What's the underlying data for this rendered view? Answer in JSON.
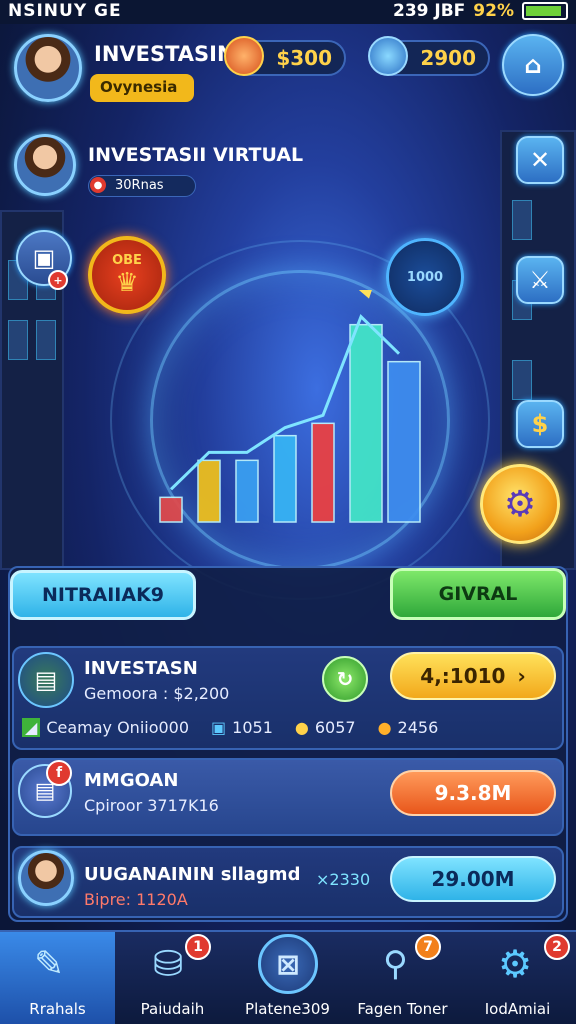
{
  "status_bar": {
    "left": "NSINUY GE",
    "time": "239 JBF",
    "battery": "92%",
    "battery_level": 0.92
  },
  "header": {
    "player_name": "INVESTASIN",
    "player_subtitle": "Ovynesia",
    "currency_coins": "$300",
    "currency_gems": "2900",
    "home_icon": "home-icon"
  },
  "profile": {
    "title": "INVESTASII VIRTUAL",
    "subtitle": "30Rnas"
  },
  "hud_left": {
    "badge_text": "OBE"
  },
  "hud_right": {
    "dial_text": "1000",
    "sword_icon": "sword-icon",
    "dollar_icon": "dollar-icon",
    "gear_icon": "gear-icon",
    "close_icon": "close-icon"
  },
  "chart_data": {
    "type": "bar",
    "values": [
      2,
      5,
      5,
      7,
      8,
      16,
      13
    ],
    "categories": [
      "",
      "",
      "",
      "",
      "",
      "",
      ""
    ],
    "series_colors": [
      "#e34a4a",
      "#f2c21b",
      "#3aa0f2",
      "#37b5f5",
      "#ee4040",
      "#43e8c8",
      "#3e8ef0"
    ]
  },
  "tabs": {
    "left": "NITRAIIAK9",
    "right": "GIVRAL"
  },
  "rows": [
    {
      "title": "INVESTASN",
      "subtitle": "Gemoora : $2,200",
      "button": "4,:1010",
      "stats": [
        {
          "label": "Ceamay Oniio000"
        },
        {
          "label": "1051"
        },
        {
          "label": "6057"
        },
        {
          "label": "2456"
        }
      ]
    },
    {
      "title": "MMGOAN",
      "subtitle": "Cpiroor 3717K16",
      "button": "9.3.8M"
    },
    {
      "title": "UUGANAININ sllagmd",
      "subtitle": "Bipre: 1120A",
      "extra": "×2330",
      "button": "29.00M"
    }
  ],
  "bottom_nav": [
    {
      "label": "Rrahals"
    },
    {
      "label": "Paiudaih",
      "badge": "1"
    },
    {
      "label": "Platene309"
    },
    {
      "label": "Fagen Toner",
      "badge": "7"
    },
    {
      "label": "IodAmiai",
      "badge": "2"
    }
  ]
}
